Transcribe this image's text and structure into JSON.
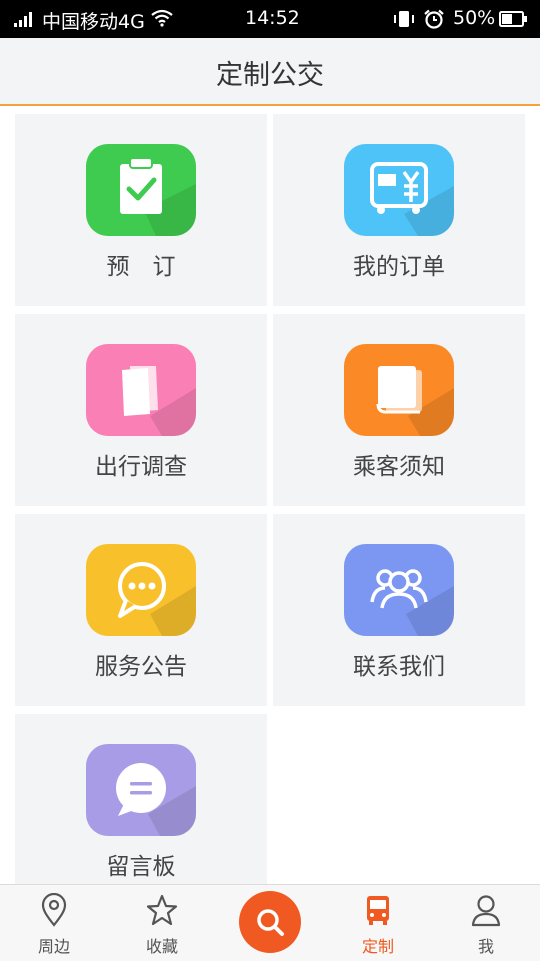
{
  "status_bar": {
    "carrier": "中国移动4G",
    "time": "14:52",
    "battery": "50%"
  },
  "header": {
    "title": "定制公交"
  },
  "menu": {
    "items": [
      {
        "label": "预　订",
        "icon": "clipboard-check-icon",
        "color": "#3fcb4f"
      },
      {
        "label": "我的订单",
        "icon": "bus-yen-icon",
        "color": "#4ec3f7"
      },
      {
        "label": "出行调查",
        "icon": "survey-papers-icon",
        "color": "#f97fb4"
      },
      {
        "label": "乘客须知",
        "icon": "notice-book-icon",
        "color": "#fb8a26"
      },
      {
        "label": "服务公告",
        "icon": "speech-bubble-dots-icon",
        "color": "#f8c12c"
      },
      {
        "label": "联系我们",
        "icon": "group-people-icon",
        "color": "#7b97f2"
      },
      {
        "label": "留言板",
        "icon": "message-bubble-icon",
        "color": "#a99ce6"
      }
    ]
  },
  "tabbar": {
    "nearby": "周边",
    "favorites": "收藏",
    "search_icon": "search-icon",
    "custom": "定制",
    "me": "我",
    "active_color": "#f05a22"
  }
}
